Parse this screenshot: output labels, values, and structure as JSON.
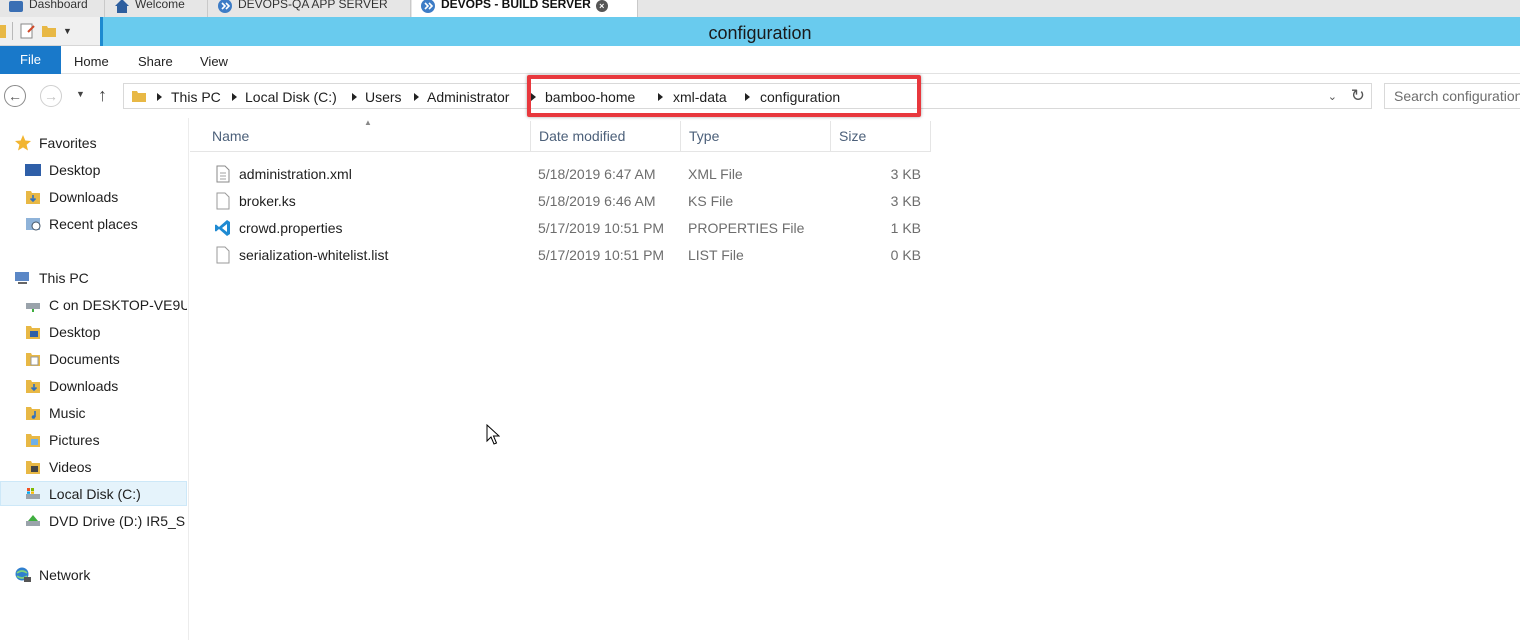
{
  "tabs": [
    {
      "label": "Dashboard",
      "icon": "dashboard-icon"
    },
    {
      "label": "Welcome",
      "icon": "home-icon"
    },
    {
      "label": "DEVOPS-QA APP SERVER",
      "icon": "remote-desktop-icon"
    },
    {
      "label": "DEVOPS - BUILD SERVER",
      "icon": "remote-desktop-icon",
      "active": true
    }
  ],
  "window": {
    "title": "configuration"
  },
  "ribbon": {
    "file": "File",
    "home": "Home",
    "share": "Share",
    "view": "View"
  },
  "address": {
    "crumbs": [
      "This PC",
      "Local Disk (C:)",
      "Users",
      "Administrator",
      "bamboo-home",
      "xml-data",
      "configuration"
    ],
    "highlight_color": "#e8383d"
  },
  "search": {
    "placeholder": "Search configuration"
  },
  "navpane": {
    "favorites": "Favorites",
    "fav_items": [
      "Desktop",
      "Downloads",
      "Recent places"
    ],
    "thispc": "This PC",
    "pc_items": [
      "C on DESKTOP-VE9U",
      "Desktop",
      "Documents",
      "Downloads",
      "Music",
      "Pictures",
      "Videos",
      "Local Disk (C:)",
      "DVD Drive (D:) IR5_S"
    ],
    "selected": "Local Disk (C:)",
    "network": "Network"
  },
  "columns": {
    "name": "Name",
    "date": "Date modified",
    "type": "Type",
    "size": "Size"
  },
  "files": [
    {
      "name": "administration.xml",
      "date": "5/18/2019 6:47 AM",
      "type": "XML File",
      "size": "3 KB",
      "icon": "xml-file-icon"
    },
    {
      "name": "broker.ks",
      "date": "5/18/2019 6:46 AM",
      "type": "KS File",
      "size": "3 KB",
      "icon": "file-icon"
    },
    {
      "name": "crowd.properties",
      "date": "5/17/2019 10:51 PM",
      "type": "PROPERTIES File",
      "size": "1 KB",
      "icon": "vscode-icon"
    },
    {
      "name": "serialization-whitelist.list",
      "date": "5/17/2019 10:51 PM",
      "type": "LIST File",
      "size": "0 KB",
      "icon": "file-icon"
    }
  ],
  "colors": {
    "titlebar": "#69cbee",
    "file_tab": "#1979ca",
    "selected_nav": "#e5f3fb"
  }
}
